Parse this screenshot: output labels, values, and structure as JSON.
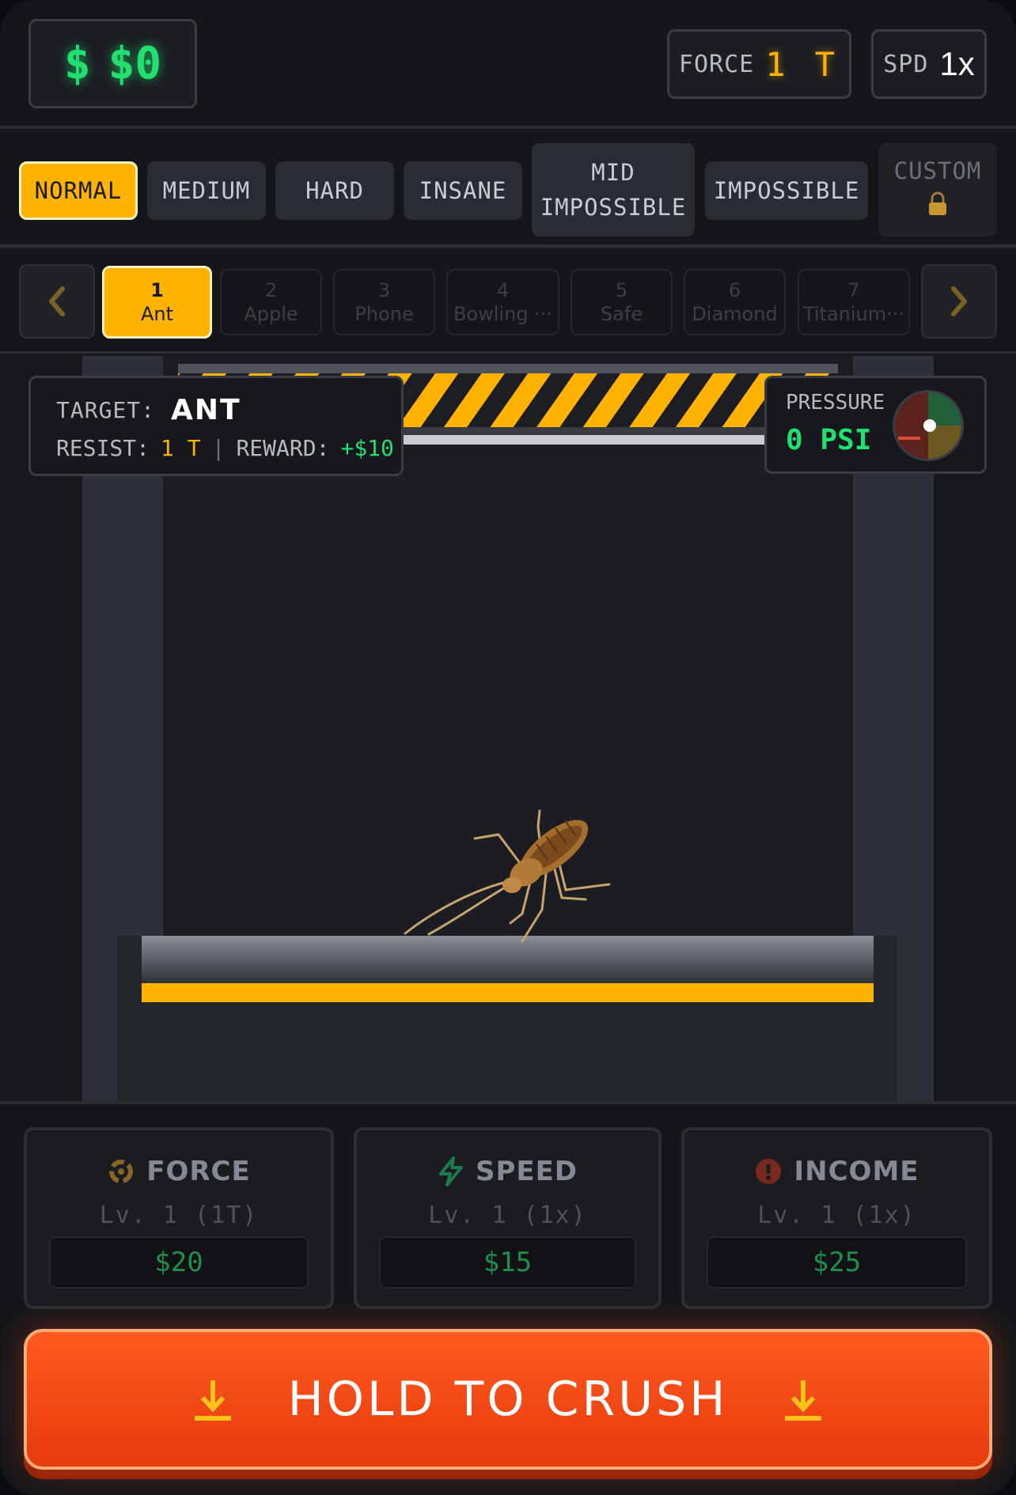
{
  "topbar": {
    "money_symbol": "$",
    "money_value": "$0",
    "force_label": "FORCE",
    "force_value": "1 T",
    "speed_label": "SPD",
    "speed_value": "1x"
  },
  "difficulties": [
    {
      "label": "NORMAL",
      "state": "active"
    },
    {
      "label": "MEDIUM",
      "state": "normal"
    },
    {
      "label": "HARD",
      "state": "normal"
    },
    {
      "label": "INSANE",
      "state": "normal"
    },
    {
      "label_line1": "MID",
      "label_line2": "IMPOSSIBLE",
      "state": "normal"
    },
    {
      "label": "IMPOSSIBLE",
      "state": "normal"
    },
    {
      "label": "CUSTOM",
      "icon": "lock-icon",
      "state": "locked"
    }
  ],
  "levels": [
    {
      "num": "1",
      "name": "Ant",
      "state": "active"
    },
    {
      "num": "2",
      "name": "Apple",
      "state": "locked"
    },
    {
      "num": "3",
      "name": "Phone",
      "state": "locked"
    },
    {
      "num": "4",
      "name": "Bowling ···",
      "state": "locked"
    },
    {
      "num": "5",
      "name": "Safe",
      "state": "locked"
    },
    {
      "num": "6",
      "name": "Diamond",
      "state": "locked"
    },
    {
      "num": "7",
      "name": "Titanium···",
      "state": "locked"
    }
  ],
  "target": {
    "label": "TARGET:",
    "name": "ANT",
    "resist_label": "RESIST:",
    "resist_value": "1 T",
    "separator": "|",
    "reward_label": "REWARD:",
    "reward_value": "+$10"
  },
  "pressure": {
    "label": "PRESSURE",
    "value": "0 PSI",
    "gauge_level": 0
  },
  "upgrades": [
    {
      "title": "FORCE",
      "icon": "force-icon",
      "level": "Lv. 1 (1T)",
      "price": "$20"
    },
    {
      "title": "SPEED",
      "icon": "lightning-icon",
      "level": "Lv. 1 (1x)",
      "price": "$15"
    },
    {
      "title": "INCOME",
      "icon": "alert-icon",
      "level": "Lv. 1 (1x)",
      "price": "$25"
    }
  ],
  "crush_button": {
    "label": "HOLD TO CRUSH",
    "icon": "download-arrow-icon"
  },
  "colors": {
    "accent": "#ffb300",
    "money": "#22e070",
    "crush": "#ff5a1f"
  }
}
